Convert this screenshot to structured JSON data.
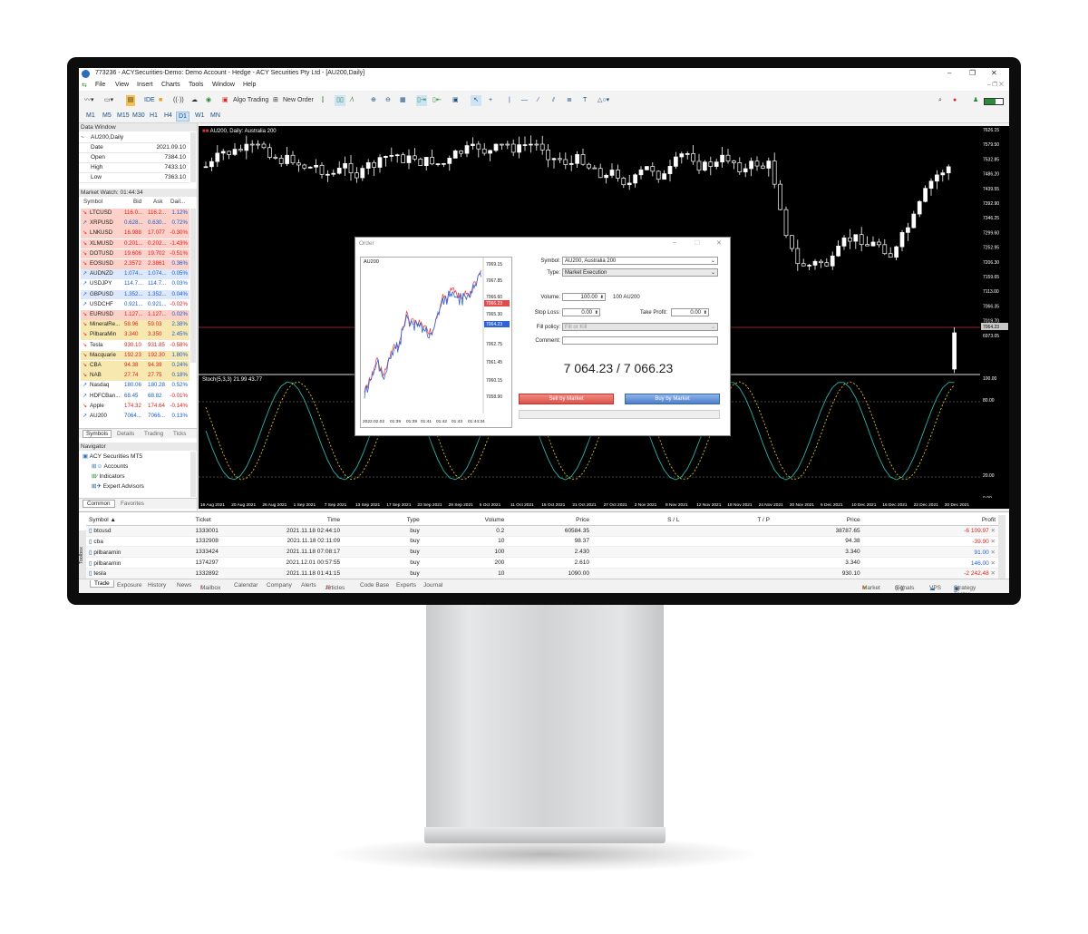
{
  "window": {
    "title": "773236 - ACYSecurities-Demo: Demo Account - Hedge - ACY Securities Pty Ltd - [AU200,Daily]"
  },
  "menu": [
    "File",
    "View",
    "Insert",
    "Charts",
    "Tools",
    "Window",
    "Help"
  ],
  "toolbar": {
    "algo_trading": "Algo Trading",
    "new_order": "New Order",
    "ide": "IDE"
  },
  "timeframes": [
    "M1",
    "M5",
    "M15",
    "M30",
    "H1",
    "H4",
    "D1",
    "W1",
    "MN"
  ],
  "active_timeframe": "D1",
  "data_window": {
    "header": "Data Window",
    "instrument": "AU200,Daily",
    "rows": [
      {
        "k": "Date",
        "v": "2021.09.10"
      },
      {
        "k": "Open",
        "v": "7384.10"
      },
      {
        "k": "High",
        "v": "7433.10"
      },
      {
        "k": "Low",
        "v": "7363.10"
      }
    ]
  },
  "market_watch": {
    "header": "Market Watch: 01:44:34",
    "columns": [
      "Symbol",
      "Bid",
      "Ask",
      "Dail..."
    ],
    "rows": [
      {
        "s": "LTCUSD",
        "b": "116.0...",
        "a": "116.2...",
        "d": "1.12%",
        "dir": "dn",
        "bg": "#fbd1c9"
      },
      {
        "s": "XRPUSD",
        "b": "0.628...",
        "a": "0.630...",
        "d": "0.72%",
        "dir": "up",
        "bg": "#fbd1c9"
      },
      {
        "s": "LNKUSD",
        "b": "16.988",
        "a": "17.077",
        "d": "-0.30%",
        "dir": "dn",
        "bg": "#fbd1c9"
      },
      {
        "s": "XLMUSD",
        "b": "0.201...",
        "a": "0.202...",
        "d": "-1.43%",
        "dir": "dn",
        "bg": "#fbd1c9"
      },
      {
        "s": "DOTUSD",
        "b": "19.606",
        "a": "19.702",
        "d": "-0.51%",
        "dir": "dn",
        "bg": "#fbd1c9"
      },
      {
        "s": "EOSUSD",
        "b": "2.3572",
        "a": "2.3861",
        "d": "0.36%",
        "dir": "dn",
        "bg": "#fbd1c9"
      },
      {
        "s": "AUDNZD",
        "b": "1.074...",
        "a": "1.074...",
        "d": "0.05%",
        "dir": "up",
        "bg": "#dde9fb"
      },
      {
        "s": "USDJPY",
        "b": "114.7...",
        "a": "114.7...",
        "d": "0.03%",
        "dir": "up",
        "bg": "#ffffff"
      },
      {
        "s": "GBPUSD",
        "b": "1.352...",
        "a": "1.352...",
        "d": "0.04%",
        "dir": "up",
        "bg": "#dde9fb"
      },
      {
        "s": "USDCHF",
        "b": "0.921...",
        "a": "0.921...",
        "d": "-0.02%",
        "dir": "up",
        "bg": "#ffffff"
      },
      {
        "s": "EURUSD",
        "b": "1.127...",
        "a": "1.127...",
        "d": "0.02%",
        "dir": "dn",
        "bg": "#fbd1c9"
      },
      {
        "s": "MineralRe...",
        "b": "58.96",
        "a": "59.03",
        "d": "2.38%",
        "dir": "dn",
        "bg": "#f7e8b0"
      },
      {
        "s": "PilbaraMin",
        "b": "3.340",
        "a": "3.350",
        "d": "2.45%",
        "dir": "dn",
        "bg": "#f7e8b0"
      },
      {
        "s": "Tesla",
        "b": "930.10",
        "a": "931.85",
        "d": "-0.58%",
        "dir": "dn",
        "bg": "#ffffff"
      },
      {
        "s": "Macquarie",
        "b": "192.23",
        "a": "192.30",
        "d": "1.80%",
        "dir": "dn",
        "bg": "#f7e8b0"
      },
      {
        "s": "CBA",
        "b": "94.38",
        "a": "94.39",
        "d": "0.24%",
        "dir": "dn",
        "bg": "#f7e8b0"
      },
      {
        "s": "NAB",
        "b": "27.74",
        "a": "27.75",
        "d": "0.18%",
        "dir": "dn",
        "bg": "#f7e8b0"
      },
      {
        "s": "Nasdaq",
        "b": "180.06",
        "a": "180.28",
        "d": "0.52%",
        "dir": "up",
        "bg": "#ffffff"
      },
      {
        "s": "HDFCBan...",
        "b": "68.45",
        "a": "68.82",
        "d": "-0.01%",
        "dir": "up",
        "bg": "#ffffff"
      },
      {
        "s": "Apple",
        "b": "174.32",
        "a": "174.64",
        "d": "-0.14%",
        "dir": "dn",
        "bg": "#ffffff"
      },
      {
        "s": "AU200",
        "b": "7064...",
        "a": "7066...",
        "d": "0.13%",
        "dir": "up",
        "bg": "#ffffff"
      }
    ],
    "tabs": [
      "Symbols",
      "Details",
      "Trading",
      "Ticks"
    ]
  },
  "navigator": {
    "header": "Navigator",
    "items": [
      "ACY Securities MT5",
      "Accounts",
      "Indicators",
      "Expert Advisors"
    ],
    "tabs": [
      "Common",
      "Favorites"
    ]
  },
  "chart": {
    "label": "AU200, Daily:  Australia 200",
    "stoch_label": "Stoch(5,3,3) 21.99 43.77",
    "price_labels": [
      "7626.15",
      "7579.50",
      "7532.85",
      "7486.20",
      "7439.55",
      "7392.90",
      "7346.25",
      "7299.60",
      "7252.95",
      "7206.30",
      "7159.65",
      "7113.00",
      "7066.35",
      "7019.70",
      "6973.05"
    ],
    "current_price": "7064.23",
    "stoch_levels": [
      "100.00",
      "80.00",
      "20.00",
      "0.00"
    ],
    "time_labels": [
      "16 Aug 2021",
      "20 Aug 2021",
      "26 Aug 2021",
      "1 Sep 2021",
      "7 Sep 2021",
      "13 Sep 2021",
      "17 Sep 2021",
      "23 Sep 2021",
      "29 Sep 2021",
      "5 Oct 2021",
      "11 Oct 2021",
      "15 Oct 2021",
      "21 Oct 2021",
      "27 Oct 2021",
      "2 Nov 2021",
      "8 Nov 2021",
      "12 Nov 2021",
      "18 Nov 2021",
      "24 Nov 2021",
      "30 Nov 2021",
      "6 Dec 2021",
      "10 Dec 2021",
      "16 Dec 2021",
      "22 Dec 2021",
      "30 Dec 2021"
    ]
  },
  "order_dialog": {
    "title": "Order",
    "mini_chart_label": "AU200",
    "mini_prices": [
      "7069.15",
      "7067.85",
      "7066.60",
      "7066.23",
      "7064.23",
      "7065.30",
      "7062.75",
      "7061.45",
      "7060.15",
      "7058.90"
    ],
    "mini_times": [
      "2022.02.02",
      "01:39",
      "01:39",
      "01:41",
      "01:42",
      "01:43",
      "01:44:34"
    ],
    "symbol_label": "Symbol:",
    "symbol_value": "AU200, Australia 200",
    "type_label": "Type:",
    "type_value": "Market Execution",
    "volume_label": "Volume:",
    "volume_value": "100.00",
    "volume_unit": "100 AU200",
    "sl_label": "Stop Loss:",
    "sl_value": "0.00",
    "tp_label": "Take Profit:",
    "tp_value": "0.00",
    "fill_label": "Fill policy:",
    "fill_value": "Fill or Kill",
    "comment_label": "Comment:",
    "quote": "7 064.23 / 7 066.23",
    "sell_label": "Sell by Market",
    "buy_label": "Buy by Market"
  },
  "trade_table": {
    "columns": [
      "Symbol",
      "Ticket",
      "Time",
      "Type",
      "Volume",
      "Price",
      "S / L",
      "T / P",
      "Price",
      "Profit"
    ],
    "rows": [
      {
        "symbol": "btcusd",
        "ticket": "1333001",
        "time": "2021.11.18 02:44:10",
        "type": "buy",
        "volume": "0.2",
        "price": "60584.35",
        "cur": "38787.65",
        "profit": "-6 109.97",
        "neg": true
      },
      {
        "symbol": "cba",
        "ticket": "1332908",
        "time": "2021.11.18 02:11:09",
        "type": "buy",
        "volume": "10",
        "price": "98.37",
        "cur": "94.38",
        "profit": "-39.90",
        "neg": true
      },
      {
        "symbol": "pilbaramin",
        "ticket": "1333424",
        "time": "2021.11.18 07:08:17",
        "type": "buy",
        "volume": "100",
        "price": "2.430",
        "cur": "3.340",
        "profit": "91.00",
        "neg": false
      },
      {
        "symbol": "pilbaramin",
        "ticket": "1374297",
        "time": "2021.12.01 00:57:55",
        "type": "buy",
        "volume": "200",
        "price": "2.610",
        "cur": "3.340",
        "profit": "146.00",
        "neg": false
      },
      {
        "symbol": "tesla",
        "ticket": "1332892",
        "time": "2021.11.18 01:41:15",
        "type": "buy",
        "volume": "10",
        "price": "1090.00",
        "cur": "930.10",
        "profit": "-2 242.48",
        "neg": true
      }
    ]
  },
  "bottom_tabs": [
    "Trade",
    "Exposure",
    "History",
    "News",
    "Mailbox",
    "Calendar",
    "Company",
    "Alerts",
    "Articles",
    "Code Base",
    "Experts",
    "Journal"
  ],
  "bottom_tab_badges": {
    "mailbox": "7",
    "articles": "18"
  },
  "status_right": [
    "Market",
    "Signals",
    "VPS",
    "Strategy Tester"
  ],
  "toolbox_label": "Toolbox"
}
